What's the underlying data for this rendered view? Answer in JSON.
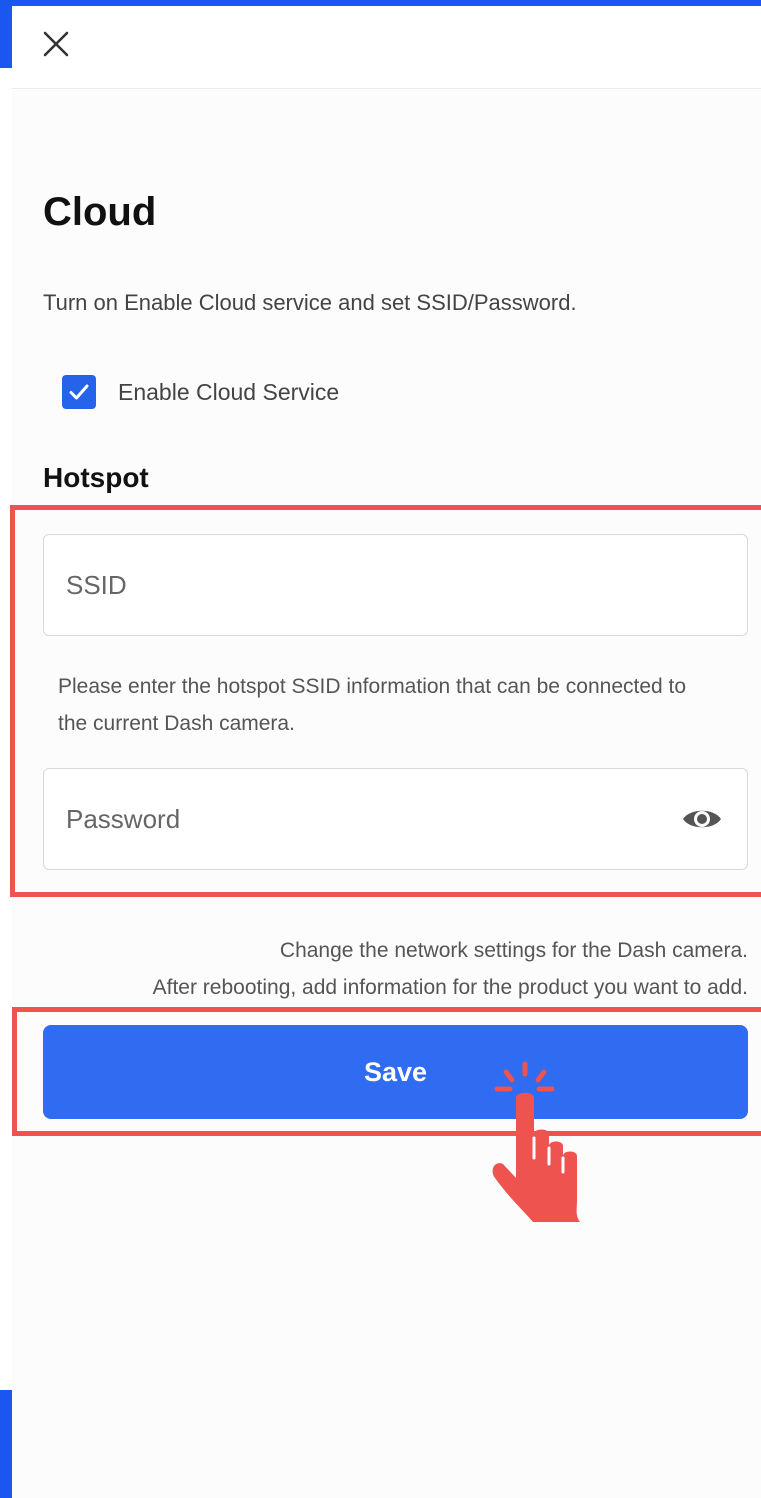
{
  "header": {
    "close_icon": "close-icon"
  },
  "page": {
    "title": "Cloud",
    "subtitle": "Turn on Enable Cloud service and set SSID/Password."
  },
  "cloud_service": {
    "label": "Enable Cloud Service",
    "checked": true
  },
  "hotspot": {
    "title": "Hotspot",
    "ssid_placeholder": "SSID",
    "ssid_hint": "Please enter the hotspot SSID information that can be connected to the current Dash camera.",
    "password_placeholder": "Password",
    "password_icon": "eye-icon"
  },
  "notice": {
    "line1": "Change the network settings for the Dash camera.",
    "line2": "After rebooting, add information for the product you want to add."
  },
  "actions": {
    "save_label": "Save"
  },
  "colors": {
    "accent": "#2f6cf1",
    "highlight": "#ef5350",
    "frame": "#1a56f0"
  }
}
